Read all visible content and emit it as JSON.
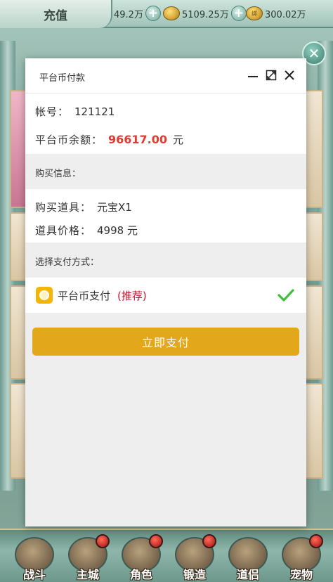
{
  "game": {
    "recharge_tab": "充值",
    "resources": [
      {
        "value": "49.2万",
        "icon": "plus-icon"
      },
      {
        "value": "5109.25万",
        "icon": "gold-coin-icon"
      },
      {
        "value": "300.02万",
        "icon": "bound-coin-icon",
        "coin_text": "绑"
      }
    ],
    "nav": [
      {
        "label": "战斗"
      },
      {
        "label": "主城"
      },
      {
        "label": "角色"
      },
      {
        "label": "锻造"
      },
      {
        "label": "道侣"
      },
      {
        "label": "宠物"
      }
    ]
  },
  "dialog": {
    "title": "平台币付款",
    "account_label": "帐号：",
    "account_value": "121121",
    "balance_label": "平台币余额：",
    "balance_value": "96617.00",
    "balance_unit": "元",
    "purchase_info_title": "购买信息：",
    "item_label": "购买道具：",
    "item_value": "元宝X1",
    "price_label": "道具价格：",
    "price_value": "4998 元",
    "payment_method_title": "选择支付方式：",
    "payment_option_label": "平台币支付",
    "payment_option_tag": "(推荐)",
    "pay_button": "立即支付"
  },
  "colors": {
    "balance": "#e23b33",
    "recommend": "#d0142c",
    "check": "#3fbf3a",
    "pay_button": "#e3a71b"
  }
}
